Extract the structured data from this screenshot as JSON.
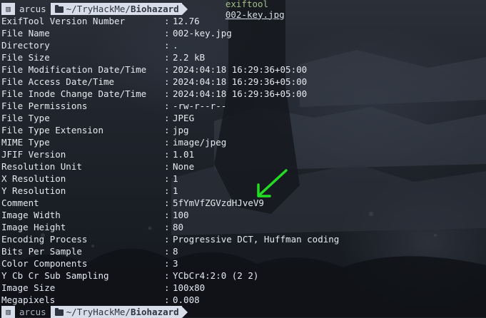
{
  "terminal": {
    "top_prompt": {
      "user": "arcus",
      "path_prefix": "~/TryHackMe/",
      "path_dir": "Biohazard",
      "command": "exiftool",
      "argument": "002-key.jpg"
    },
    "rows": [
      {
        "key": "ExifTool Version Number",
        "value": "12.76"
      },
      {
        "key": "File Name",
        "value": "002-key.jpg"
      },
      {
        "key": "Directory",
        "value": "."
      },
      {
        "key": "File Size",
        "value": "2.2 kB"
      },
      {
        "key": "File Modification Date/Time",
        "value": "2024:04:18 16:29:36+05:00"
      },
      {
        "key": "File Access Date/Time",
        "value": "2024:04:18 16:29:36+05:00"
      },
      {
        "key": "File Inode Change Date/Time",
        "value": "2024:04:18 16:29:36+05:00"
      },
      {
        "key": "File Permissions",
        "value": "-rw-r--r--"
      },
      {
        "key": "File Type",
        "value": "JPEG"
      },
      {
        "key": "File Type Extension",
        "value": "jpg"
      },
      {
        "key": "MIME Type",
        "value": "image/jpeg"
      },
      {
        "key": "JFIF Version",
        "value": "1.01"
      },
      {
        "key": "Resolution Unit",
        "value": "None"
      },
      {
        "key": "X Resolution",
        "value": "1"
      },
      {
        "key": "Y Resolution",
        "value": "1"
      },
      {
        "key": "Comment",
        "value": "5fYmVfZGVzdHJveV9"
      },
      {
        "key": "Image Width",
        "value": "100"
      },
      {
        "key": "Image Height",
        "value": "80"
      },
      {
        "key": "Encoding Process",
        "value": "Progressive DCT, Huffman coding"
      },
      {
        "key": "Bits Per Sample",
        "value": "8"
      },
      {
        "key": "Color Components",
        "value": "3"
      },
      {
        "key": "Y Cb Cr Sub Sampling",
        "value": "YCbCr4:2:0 (2 2)"
      },
      {
        "key": "Image Size",
        "value": "100x80"
      },
      {
        "key": "Megapixels",
        "value": "0.008"
      }
    ],
    "bottom_prompt": {
      "user": "arcus",
      "path_prefix": "~/TryHackMe/",
      "path_dir": "Biohazard"
    },
    "separator": ":",
    "colors": {
      "text": "#e5e9f0",
      "command": "#a3be8c",
      "segment_bg": "#d8dee9",
      "annotation_arrow": "#22dd22"
    }
  }
}
